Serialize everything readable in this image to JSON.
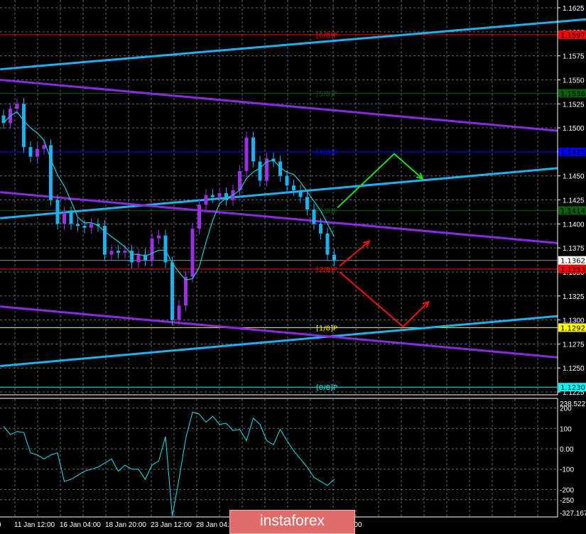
{
  "chart_data": [
    {
      "type": "candlestick",
      "title": "",
      "ylim": [
        1.122,
        1.1633
      ],
      "y_ticks": [
        "1.1625",
        "1.1600",
        "1.1575",
        "1.1550",
        "1.1525",
        "1.1500",
        "1.1475",
        "1.1450",
        "1.1425",
        "1.1400",
        "1.1375",
        "1.1350",
        "1.1325",
        "1.1300",
        "1.1275",
        "1.1250",
        "1.1225"
      ],
      "x_tick_labels": [
        "0",
        "11 Jan 12:00",
        "16 Jan 04:00",
        "18 Jan 20:00",
        "23 Jan 12:00",
        "28 Jan 04:00",
        "4:00"
      ],
      "closes": [
        1.1505,
        1.152,
        1.1525,
        1.148,
        1.147,
        1.1478,
        1.1482,
        1.1425,
        1.14,
        1.1412,
        1.14,
        1.1398,
        1.1396,
        1.14,
        1.1398,
        1.1368,
        1.1372,
        1.137,
        1.1372,
        1.136,
        1.1368,
        1.1362,
        1.1385,
        1.1388,
        1.136,
        1.13,
        1.1315,
        1.1345,
        1.1395,
        1.142,
        1.143,
        1.1428,
        1.1432,
        1.1425,
        1.1435,
        1.1455,
        1.149,
        1.1465,
        1.1445,
        1.1468,
        1.1465,
        1.145,
        1.144,
        1.1435,
        1.1428,
        1.1415,
        1.14,
        1.139,
        1.1368,
        1.1362
      ],
      "moving_average_period": 5,
      "levels": [
        {
          "label": "[6/8]P",
          "price": "1.1597",
          "color": "#ff0000",
          "text_color": "#000000"
        },
        {
          "label": "[5/8]P",
          "price": "1.1536",
          "color": "#0b5e0b",
          "text_color": "#000000"
        },
        {
          "label": "[4/8]P",
          "price": "1.1475",
          "color": "#0000ff",
          "text_color": "#000000"
        },
        {
          "label": "[3/8]P",
          "price": "1.1414",
          "color": "#0b5e0b",
          "text_color": "#000000"
        },
        {
          "label": "[2/8]P",
          "price": "1.1353",
          "color": "#ff0000",
          "text_color": "#000000"
        },
        {
          "label": "[1/8]P",
          "price": "1.1292",
          "color": "#ffff00",
          "text_color": "#000000"
        },
        {
          "label": "[0/8]P",
          "price": "1.1230",
          "color": "#00ffff",
          "text_color": "#000000"
        }
      ],
      "current_price": {
        "price": "1.1362",
        "color": "#ffffff"
      },
      "channel_lines": [
        {
          "color": "#1ab2f0",
          "points": [
            [
              -0.5,
              1.1561
            ],
            [
              86.3,
              1.1613
            ]
          ]
        },
        {
          "color": "#1ab2f0",
          "points": [
            [
              -0.5,
              1.1406
            ],
            [
              82.1,
              1.1458
            ]
          ]
        },
        {
          "color": "#1ab2f0",
          "points": [
            [
              -0.5,
              1.1252
            ],
            [
              82.1,
              1.1304
            ]
          ]
        },
        {
          "color": "#8a2be2",
          "points": [
            [
              -0.5,
              1.155
            ],
            [
              82.1,
              1.1497
            ]
          ]
        },
        {
          "color": "#8a2be2",
          "points": [
            [
              -0.5,
              1.1433
            ],
            [
              82.1,
              1.138
            ]
          ]
        },
        {
          "color": "#8a2be2",
          "points": [
            [
              -0.5,
              1.1314
            ],
            [
              82.1,
              1.1261
            ]
          ]
        }
      ],
      "forecast_arrows": [
        {
          "color": "#22dd22",
          "points": [
            [
              49.5,
              1.1417
            ],
            [
              57.9,
              1.1473
            ],
            [
              62.1,
              1.1447
            ]
          ]
        },
        {
          "color": "#ee1111",
          "points": [
            [
              49.8,
              1.1356
            ],
            [
              54.2,
              1.1382
            ]
          ]
        },
        {
          "color": "#ee1111",
          "points": [
            [
              49.8,
              1.135
            ],
            [
              59.2,
              1.1293
            ],
            [
              63.0,
              1.1319
            ]
          ]
        }
      ]
    },
    {
      "type": "line",
      "title": "CCI",
      "ylim": [
        -327.167,
        238.5227
      ],
      "y_ticks": [
        "238.5227",
        "200",
        "100",
        "0.00",
        "-100",
        "-200",
        "-250",
        "-327.167"
      ],
      "values": [
        110,
        70,
        85,
        80,
        -20,
        -30,
        -50,
        -30,
        -20,
        -160,
        -150,
        -130,
        -110,
        -100,
        -90,
        -70,
        -50,
        -110,
        -80,
        -100,
        -100,
        -150,
        -80,
        -60,
        60,
        -330,
        -150,
        50,
        180,
        170,
        130,
        160,
        120,
        125,
        90,
        95,
        40,
        150,
        120,
        40,
        20,
        95,
        40,
        -10,
        -50,
        -90,
        -140,
        -160,
        -180,
        -150
      ]
    }
  ],
  "logo": "instaforex"
}
